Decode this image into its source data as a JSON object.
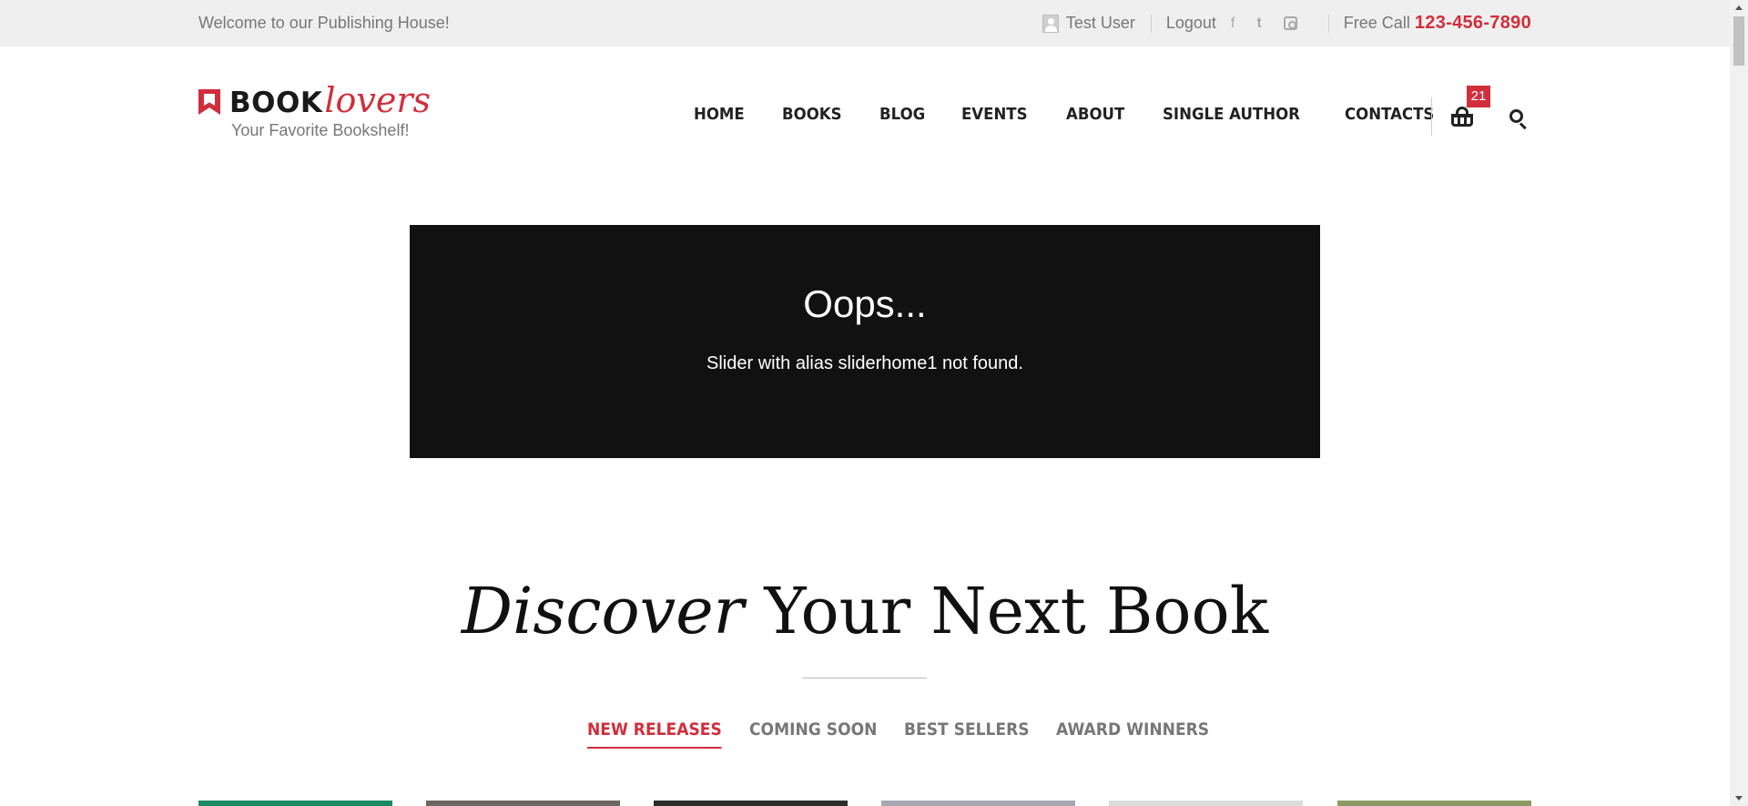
{
  "topbar": {
    "welcome": "Welcome to our Publishing House!",
    "user_name": "Test User",
    "logout": "Logout",
    "free_call_label": "Free Call",
    "phone": "123-456-7890",
    "social": [
      "facebook-icon",
      "twitter-icon",
      "instagram-icon"
    ]
  },
  "logo": {
    "book": "BOOK",
    "lovers": "lovers",
    "tagline": "Your Favorite Bookshelf!"
  },
  "nav": {
    "items": [
      "HOME",
      "BOOKS",
      "BLOG",
      "EVENTS",
      "ABOUT",
      "SINGLE AUTHOR",
      "CONTACTS"
    ]
  },
  "cart": {
    "count": "21"
  },
  "slider_error": {
    "title": "Oops...",
    "message": "Slider with alias sliderhome1 not found."
  },
  "discover": {
    "title_em": "Discover",
    "title_rest": " Your Next Book"
  },
  "tabs": {
    "items": [
      "NEW RELEASES",
      "COMING SOON",
      "BEST SELLERS",
      "AWARD WINNERS"
    ],
    "active": "NEW RELEASES"
  },
  "book_covers": [
    "#1b8a64",
    "#6b6660",
    "#2c2c2c",
    "#a9a7b2",
    "#dcdcdc",
    "#8b9a64"
  ],
  "colors": {
    "accent": "#d12e3c",
    "topbar_bg": "#efefef",
    "slider_bg": "#111111"
  }
}
